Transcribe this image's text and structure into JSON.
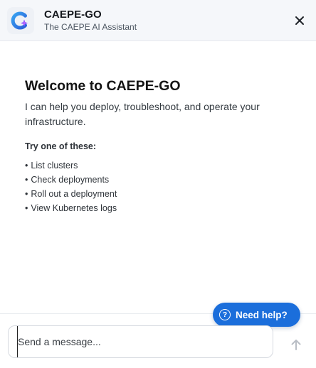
{
  "header": {
    "title": "CAEPE-GO",
    "subtitle": "The CAEPE AI Assistant",
    "logo_icon": "caepe-logo-icon",
    "close_icon": "close-icon"
  },
  "welcome": {
    "title": "Welcome to CAEPE-GO",
    "text": "I can help you deploy, troubleshoot, and operate your infrastructure.",
    "try_title": "Try one of these:",
    "suggestions": [
      "List clusters",
      "Check deployments",
      "Roll out a deployment",
      "View Kubernetes logs"
    ]
  },
  "help_button": {
    "label": "Need help?",
    "icon": "question-icon"
  },
  "composer": {
    "placeholder": "Send a message...",
    "value": "",
    "send_icon": "arrow-up-icon"
  },
  "colors": {
    "header_bg": "#f5f7fa",
    "accent": "#1b6edb",
    "logo_blue": "#2a7de1",
    "logo_purple": "#8a4fff"
  }
}
